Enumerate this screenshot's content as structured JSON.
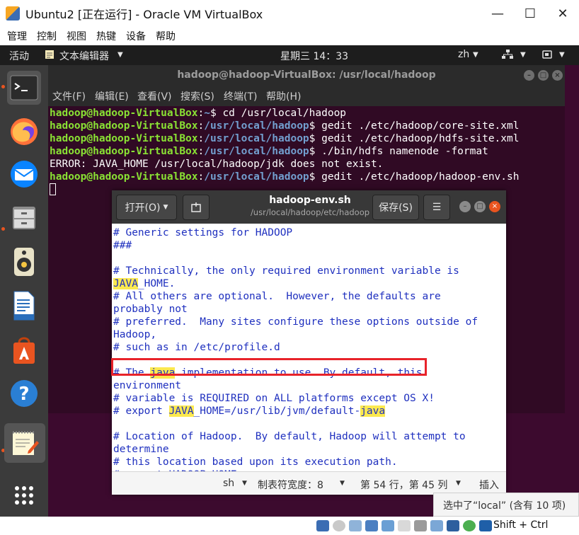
{
  "window": {
    "title": "Ubuntu2 [正在运行] - Oracle VM VirtualBox",
    "minimize": "—",
    "maximize": "☐",
    "close": "✕"
  },
  "vbox_menu": [
    "管理",
    "控制",
    "视图",
    "热键",
    "设备",
    "帮助"
  ],
  "gnome": {
    "activities": "活动",
    "app_menu": "文本编辑器",
    "clock": "星期三 14：33",
    "input_method": "zh"
  },
  "terminal": {
    "title": "hadoop@hadoop-VirtualBox: /usr/local/hadoop",
    "menu": [
      "文件(F)",
      "编辑(E)",
      "查看(V)",
      "搜索(S)",
      "终端(T)",
      "帮助(H)"
    ],
    "lines": [
      {
        "user": "hadoop@hadoop-VirtualBox",
        "path": "~",
        "cmd": "$ cd /usr/local/hadoop"
      },
      {
        "user": "hadoop@hadoop-VirtualBox",
        "path": "/usr/local/hadoop",
        "cmd": "$ gedit ./etc/hadoop/core-site.xml"
      },
      {
        "user": "hadoop@hadoop-VirtualBox",
        "path": "/usr/local/hadoop",
        "cmd": "$ gedit ./etc/hadoop/hdfs-site.xml"
      },
      {
        "user": "hadoop@hadoop-VirtualBox",
        "path": "/usr/local/hadoop",
        "cmd": "$ ./bin/hdfs namenode -format"
      },
      {
        "plain": "ERROR: JAVA_HOME /usr/local/hadoop/jdk does not exist."
      },
      {
        "user": "hadoop@hadoop-VirtualBox",
        "path": "/usr/local/hadoop",
        "cmd": "$ gedit ./etc/hadoop/hadoop-env.sh"
      }
    ]
  },
  "gedit": {
    "open_label": "打开(O)",
    "title": "hadoop-env.sh",
    "subtitle": "/usr/local/hadoop/etc/hadoop",
    "save_label": "保存(S)",
    "menu_icon": "☰",
    "lines": [
      [
        "# Generic settings for HADOOP"
      ],
      [
        "###"
      ],
      [
        ""
      ],
      [
        "# Technically, the only required environment variable is"
      ],
      [
        {
          "hl": "JAVA"
        },
        "_HOME."
      ],
      [
        "# All others are optional.  However, the defaults are"
      ],
      [
        "probably not"
      ],
      [
        "# preferred.  Many sites configure these options outside of"
      ],
      [
        "Hadoop,"
      ],
      [
        "# such as in /etc/profile.d"
      ],
      [
        ""
      ],
      [
        "# The ",
        {
          "hl": "java"
        },
        " implementation to use. By default, this"
      ],
      [
        "environment"
      ],
      [
        "# variable is REQUIRED on ALL platforms except OS X!"
      ],
      [
        "# export ",
        {
          "hl": "JAVA"
        },
        "_HOME=/usr/lib/jvm/default-",
        {
          "hl": "java"
        }
      ],
      [
        ""
      ],
      [
        "# Location of Hadoop.  By default, Hadoop will attempt to"
      ],
      [
        "determine"
      ],
      [
        "# this location based upon its execution path."
      ],
      [
        "# export HADOOP_HOME="
      ]
    ],
    "status": {
      "language": "sh",
      "tab_width": "制表符宽度：8",
      "position": "第 54 行，第 45 列",
      "mode": "插入"
    }
  },
  "selection_status": "选中了“local” (含有 10 项)",
  "vbox_status": {
    "host_key": "Shift + Ctrl"
  },
  "colors": {
    "terminal_bg": "#300a24",
    "prompt_user": "#8ae234",
    "prompt_path": "#729fcf",
    "highlight": "#fce94f",
    "annotation_box": "#e8232a",
    "ubuntu_orange": "#e95420"
  },
  "dock_icons": [
    "terminal-icon",
    "firefox-icon",
    "thunderbird-icon",
    "files-icon",
    "rhythmbox-icon",
    "writer-icon",
    "software-icon",
    "help-icon",
    "text-editor-icon",
    "show-apps-icon"
  ]
}
